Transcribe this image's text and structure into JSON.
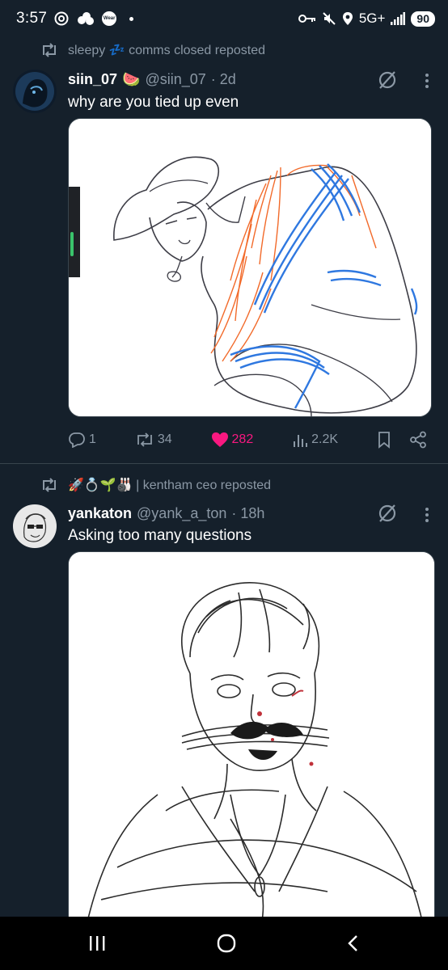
{
  "status_bar": {
    "time": "3:57",
    "wear_label": "Wear",
    "network": "5G+",
    "battery": "90"
  },
  "posts": [
    {
      "repost_label": "sleepy 💤 comms closed reposted",
      "author": "siin_07",
      "author_emoji": "🍉",
      "handle": "@siin_07",
      "time": "· 2d",
      "text": "why are you tied up even",
      "replies": "1",
      "reposts": "34",
      "likes": "282",
      "views": "2.2K",
      "liked": true,
      "media_icon": "drawing-cowboy-tied-up"
    },
    {
      "repost_label": "🚀💍🌱🎳 | kentham ceo reposted",
      "author": "yankaton",
      "handle": "@yank_a_ton",
      "time": "· 18h",
      "text": "Asking too many questions",
      "media_icon": "drawing-man-gagged"
    }
  ],
  "nav": {
    "recent": "recent-apps-icon",
    "home": "home-icon",
    "back": "back-icon"
  },
  "colors": {
    "background": "#15202b",
    "like": "#f91880",
    "muted": "#8b98a5",
    "rope_blue": "#2f78e0",
    "hair_orange": "#f26a2a"
  }
}
